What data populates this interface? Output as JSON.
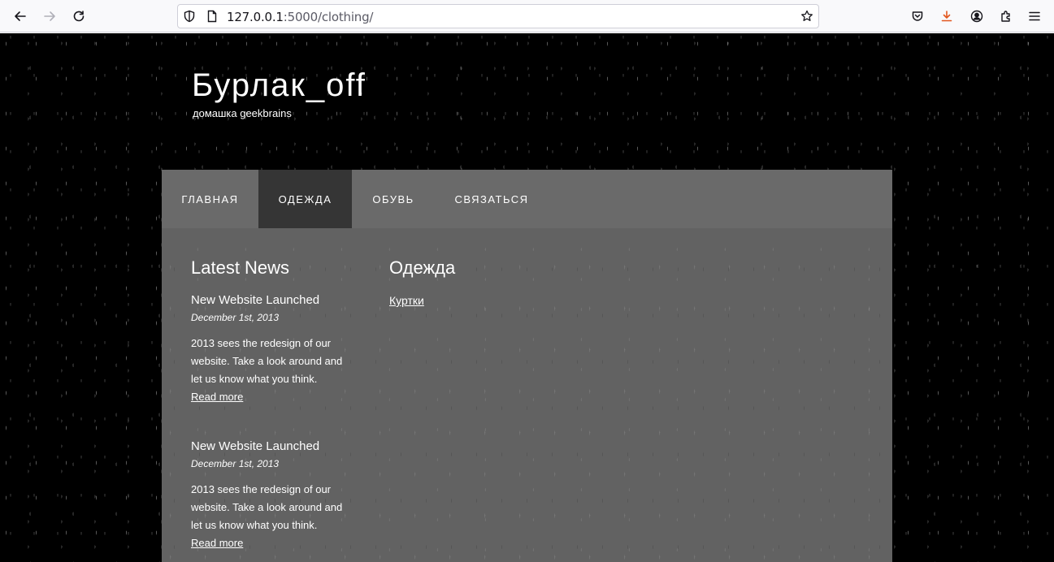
{
  "browser": {
    "url_host": "127.0.0.1",
    "url_rest": ":5000/clothing/",
    "icons": [
      "back-arrow-icon",
      "forward-arrow-icon",
      "reload-icon",
      "shield-icon",
      "page-icon",
      "star-icon",
      "pocket-icon",
      "download-icon",
      "account-icon",
      "extensions-icon",
      "hamburger-menu-icon"
    ]
  },
  "site": {
    "title": "Бурлак_off",
    "subtitle": "домашка geekbrains"
  },
  "menu": {
    "items": [
      {
        "label": "ГЛАВНАЯ"
      },
      {
        "label": "ОДЕЖДА"
      },
      {
        "label": "ОБУВЬ"
      },
      {
        "label": "СВЯЗАТЬСЯ"
      }
    ],
    "active": "ОДЕЖДА"
  },
  "sidebar": {
    "title": "Latest News",
    "news": [
      {
        "title": "New Website Launched",
        "date": "December 1st, 2013",
        "text": "2013 sees the redesign of our website. Take a look around and let us know what you think.",
        "link": "Read more"
      },
      {
        "title": "New Website Launched",
        "date": "December 1st, 2013",
        "text": "2013 sees the redesign of our website. Take a look around and let us know what you think.",
        "link": "Read more"
      }
    ]
  },
  "main": {
    "title": "Одежда",
    "links": [
      "Куртки"
    ]
  },
  "colors": {
    "page_bg": "#000000",
    "content_bg": "#626262",
    "menu_active_bg": "#353535",
    "download_accent": "#e2571e"
  }
}
